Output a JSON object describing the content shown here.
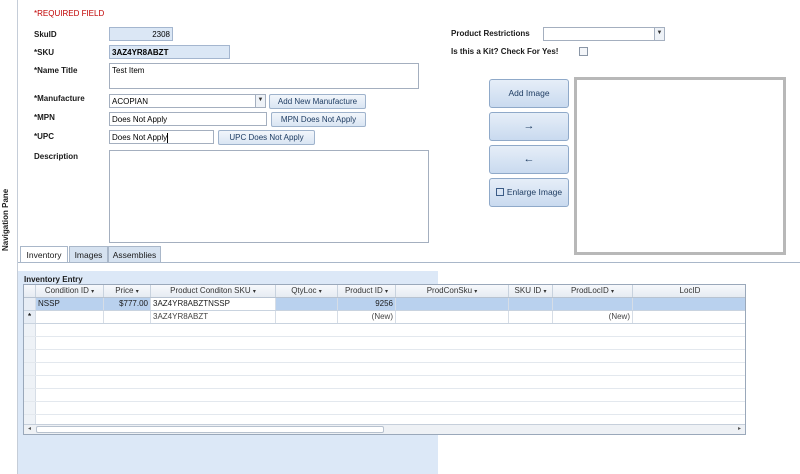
{
  "nav_pane": {
    "label": "Navigation Pane"
  },
  "form": {
    "required_note": "*REQUIRED FIELD",
    "skuid": {
      "label": "SkuID",
      "value": "2308"
    },
    "sku": {
      "label": "*SKU",
      "value": "3AZ4YR8ABZT"
    },
    "name_title": {
      "label": "*Name Title",
      "value": "Test Item"
    },
    "manufacture": {
      "label": "*Manufacture",
      "value": "ACOPIAN",
      "button": "Add New Manufacture"
    },
    "mpn": {
      "label": "*MPN",
      "value": "Does Not Apply",
      "button": "MPN Does Not Apply"
    },
    "upc": {
      "label": "*UPC",
      "value": "Does Not Apply",
      "button": "UPC Does Not Apply"
    },
    "description": {
      "label": "Description",
      "value": ""
    },
    "product_restrictions": {
      "label": "Product Restrictions",
      "value": ""
    },
    "kit": {
      "label": "Is this a Kit? Check For Yes!",
      "checked": false
    }
  },
  "image_panel": {
    "add_image": "Add Image",
    "next": "→",
    "prev": "←",
    "enlarge": "Enlarge Image"
  },
  "tabs": [
    "Inventory",
    "Images",
    "Assemblies"
  ],
  "inventory": {
    "title": "Inventory Entry",
    "columns": [
      "Condition ID",
      "Price",
      "Product Conditon SKU",
      "QtyLoc",
      "Product ID",
      "ProdConSku",
      "SKU ID",
      "ProdLocID",
      "LocID"
    ],
    "rows": [
      {
        "selector": "",
        "cells": [
          "NSSP",
          "$777.00",
          "3AZ4YR8ABZTNSSP",
          "",
          "9256",
          "",
          "",
          "",
          ""
        ]
      },
      {
        "selector": "*",
        "cells": [
          "",
          "",
          "3AZ4YR8ABZT",
          "",
          "(New)",
          "",
          "",
          "(New)",
          ""
        ]
      }
    ]
  },
  "colors": {
    "accent_blue": "#dbe7f5",
    "selected_row": "#b9d1ee",
    "subform_bg": "#dce8f7"
  }
}
